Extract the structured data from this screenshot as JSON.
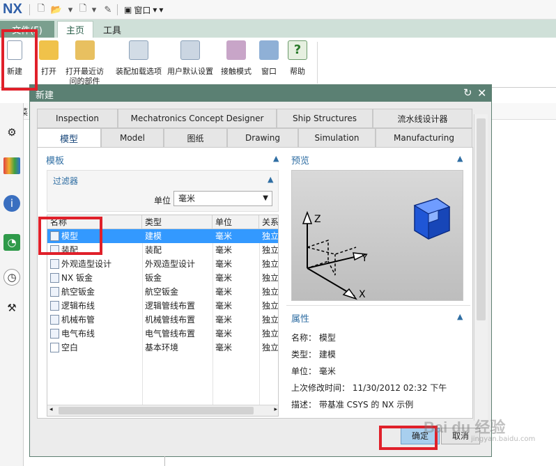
{
  "quickbar": {
    "logo": "NX",
    "window_menu_label": "窗口"
  },
  "ribbon_tabs": {
    "file": "文件(F)",
    "home": "主页",
    "tools": "工具"
  },
  "ribbon_buttons": [
    {
      "label": "新建",
      "label2": "",
      "icon": "new-file-icon"
    },
    {
      "label": "打开",
      "label2": "",
      "icon": "open-folder-icon"
    },
    {
      "label": "打开最近访",
      "label2": "问的部件",
      "icon": "recent-folder-icon"
    },
    {
      "label": "装配加载选项",
      "label2": "",
      "icon": "assembly-load-icon"
    },
    {
      "label": "用户默认设置",
      "label2": "",
      "icon": "user-defaults-icon"
    },
    {
      "label": "接触模式",
      "label2": "",
      "icon": "touch-mode-icon"
    },
    {
      "label": "窗口",
      "label2": "",
      "icon": "window-icon"
    },
    {
      "label": "帮助",
      "label2": "",
      "icon": "help-icon"
    }
  ],
  "under_bar": {
    "label": "菜"
  },
  "dialog": {
    "title": "新建",
    "tabs_row1": [
      "Inspection",
      "Mechatronics Concept Designer",
      "Ship Structures",
      "流水线设计器"
    ],
    "tabs_row2": [
      "模型",
      "Model",
      "图纸",
      "Drawing",
      "Simulation",
      "Manufacturing"
    ],
    "template_header": "模板",
    "filter_label": "过滤器",
    "unit_label": "单位",
    "unit_value": "毫米",
    "table": {
      "columns": [
        "名称",
        "类型",
        "单位",
        "关系"
      ],
      "rows": [
        {
          "name": "模型",
          "type": "建模",
          "unit": "毫米",
          "rel": "独立"
        },
        {
          "name": "装配",
          "type": "装配",
          "unit": "毫米",
          "rel": "独立"
        },
        {
          "name": "外观造型设计",
          "type": "外观造型设计",
          "unit": "毫米",
          "rel": "独立"
        },
        {
          "name": "NX 钣金",
          "type": "钣金",
          "unit": "毫米",
          "rel": "独立"
        },
        {
          "name": "航空钣金",
          "type": "航空钣金",
          "unit": "毫米",
          "rel": "独立"
        },
        {
          "name": "逻辑布线",
          "type": "逻辑管线布置",
          "unit": "毫米",
          "rel": "独立"
        },
        {
          "name": "机械布管",
          "type": "机械管线布置",
          "unit": "毫米",
          "rel": "独立"
        },
        {
          "name": "电气布线",
          "type": "电气管线布置",
          "unit": "毫米",
          "rel": "独立"
        },
        {
          "name": "空白",
          "type": "基本环境",
          "unit": "毫米",
          "rel": "独立"
        }
      ]
    },
    "preview_header": "预览",
    "preview_axes": {
      "z": "Z",
      "y": "Y",
      "x": "X"
    },
    "properties_header": "属性",
    "properties": [
      "名称： 模型",
      "类型： 建模",
      "单位： 毫米",
      "上次修改时间： 11/30/2012 02:32 下午",
      "描述： 带基准 CSYS 的 NX 示例"
    ],
    "ok_label": "确定",
    "cancel_label": "取消"
  },
  "watermark": {
    "text": "Bai du 经验",
    "sub": "jingyan.baidu.com"
  },
  "colors": {
    "title_bar": "#5b8073",
    "selection": "#3399ff",
    "highlight_box": "#e0202a",
    "panel_header": "#2f6ea3"
  }
}
